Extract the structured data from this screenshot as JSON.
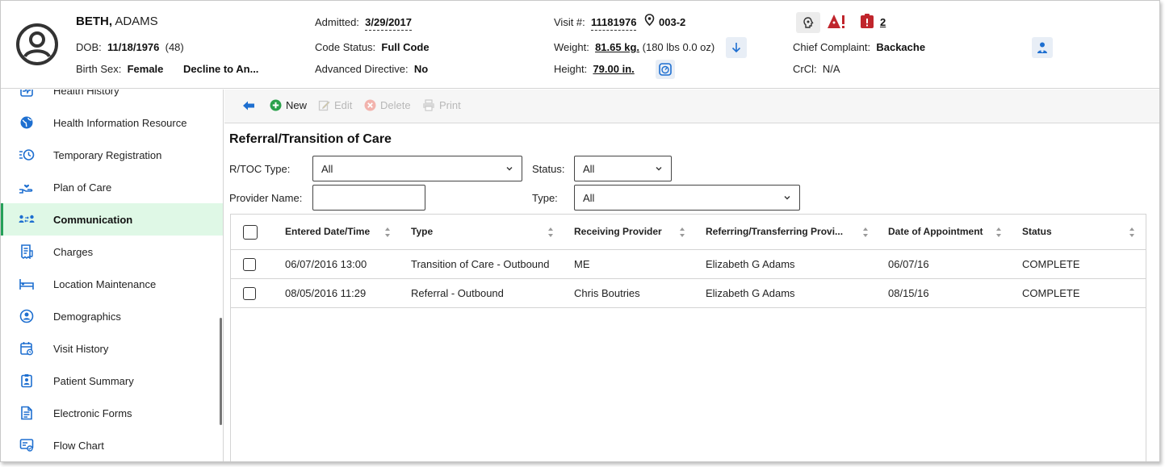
{
  "patient": {
    "last_name": "BETH,",
    "first_name": " ADAMS",
    "dob_label": "DOB:",
    "dob": "11/18/1976",
    "age": "(48)",
    "birth_sex_label": "Birth Sex:",
    "birth_sex": "Female",
    "gender_identity": "Decline to An..."
  },
  "visit": {
    "admitted_label": "Admitted:",
    "admitted": "3/29/2017",
    "code_status_label": "Code Status:",
    "code_status": "Full Code",
    "advanced_directive_label": "Advanced Directive:",
    "advanced_directive": "No",
    "visit_num_label": "Visit #:",
    "visit_num": "11181976",
    "location": "003-2",
    "weight_label": "Weight:",
    "weight": "81.65 kg.",
    "weight_alt": "(180 lbs 0.0 oz)",
    "height_label": "Height:",
    "height": "79.00 in.",
    "chief_complaint_label": "Chief Complaint:",
    "chief_complaint": "Backache",
    "crcl_label": "CrCl:",
    "crcl": "N/A",
    "alert_count": "2"
  },
  "sidebar": {
    "items": [
      {
        "label": "Health History",
        "icon": "health-history-icon"
      },
      {
        "label": "Health Information Resource",
        "icon": "globe-icon"
      },
      {
        "label": "Temporary Registration",
        "icon": "clock-list-icon"
      },
      {
        "label": "Plan of Care",
        "icon": "hand-heart-icon"
      },
      {
        "label": "Communication",
        "icon": "people-exchange-icon"
      },
      {
        "label": "Charges",
        "icon": "receipt-icon"
      },
      {
        "label": "Location Maintenance",
        "icon": "bed-icon"
      },
      {
        "label": "Demographics",
        "icon": "person-circle-icon"
      },
      {
        "label": "Visit History",
        "icon": "calendar-history-icon"
      },
      {
        "label": "Patient Summary",
        "icon": "clipboard-person-icon"
      },
      {
        "label": "Electronic Forms",
        "icon": "form-icon"
      },
      {
        "label": "Flow Chart",
        "icon": "flow-chart-icon"
      }
    ],
    "active": "Communication"
  },
  "toolbar": {
    "new": "New",
    "edit": "Edit",
    "delete": "Delete",
    "print": "Print"
  },
  "main": {
    "title": "Referral/Transition of Care",
    "filters": {
      "rtoc_type_label": "R/TOC Type:",
      "rtoc_type_value": "All",
      "status_label": "Status:",
      "status_value": "All",
      "provider_name_label": "Provider Name:",
      "provider_name_value": "",
      "type_label": "Type:",
      "type_value": "All"
    },
    "table": {
      "columns": [
        "Entered Date/Time",
        "Type",
        "Receiving Provider",
        "Referring/Transferring Provi...",
        "Date of Appointment",
        "Status"
      ],
      "rows": [
        [
          "06/07/2016 13:00",
          "Transition of Care - Outbound",
          "ME",
          "Elizabeth G Adams",
          "06/07/16",
          "COMPLETE"
        ],
        [
          "08/05/2016 11:29",
          "Referral - Outbound",
          "Chris Boutries",
          "Elizabeth G Adams",
          "08/15/16",
          "COMPLETE"
        ]
      ]
    }
  },
  "colors": {
    "accent_blue": "#1e6fd0",
    "active_green_bg": "#dff8e6",
    "alert_red": "#c0252c",
    "new_green": "#2aa14b"
  }
}
